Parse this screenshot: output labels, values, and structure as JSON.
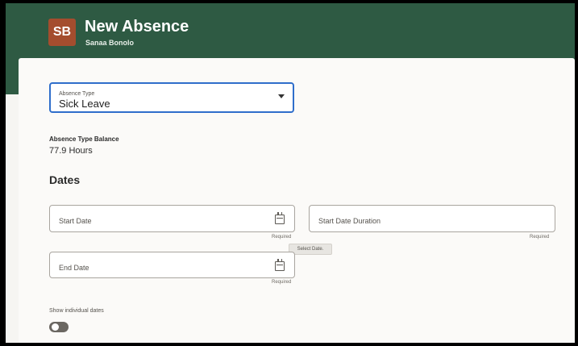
{
  "header": {
    "avatar_initials": "SB",
    "title": "New Absence",
    "subtitle": "Sanaa Bonolo",
    "colors": {
      "background": "#2e5a43",
      "avatar": "#a44d2e"
    }
  },
  "form": {
    "absence_type": {
      "label": "Absence Type",
      "value": "Sick Leave",
      "icon": "chevron-down-icon"
    },
    "balance": {
      "label": "Absence Type Balance",
      "value": "77.9 Hours"
    },
    "dates_section": {
      "title": "Dates",
      "start_date": {
        "placeholder": "Start Date",
        "required_text": "Required",
        "icon": "calendar-icon"
      },
      "start_date_duration": {
        "placeholder": "Start Date Duration",
        "required_text": "Required"
      },
      "tooltip": "Select Date.",
      "end_date": {
        "placeholder": "End Date",
        "required_text": "Required",
        "icon": "calendar-icon"
      }
    },
    "individual_dates": {
      "label": "Show individual dates",
      "enabled": false
    }
  }
}
